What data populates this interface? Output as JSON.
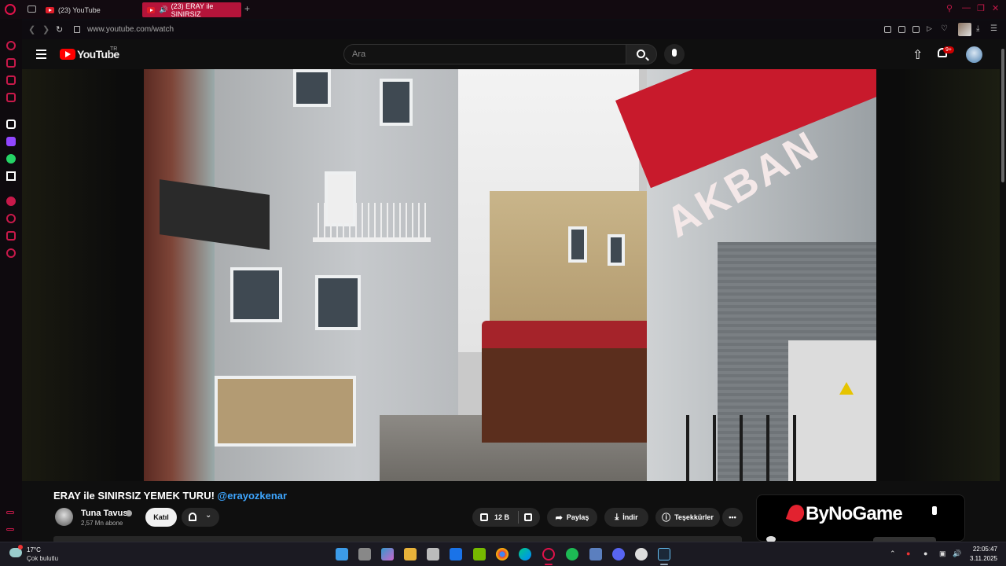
{
  "browser": {
    "tabs": [
      {
        "label": "(23) YouTube",
        "active": false
      },
      {
        "label": "(23) ERAY ile SINIRSIZ",
        "active": true
      }
    ],
    "new_tab": "+",
    "url": "www.youtube.com/watch",
    "accent": "#c8194a"
  },
  "youtube": {
    "logo_text": "YouTube",
    "country_code": "TR",
    "search_placeholder": "Ara",
    "notification_count": "9+"
  },
  "video": {
    "scene_sign": "AKBAN",
    "title_main": "ERAY ile SINIRSIZ YEMEK TURU! ",
    "title_mention": "@erayozkenar",
    "channel_name": "Tuna Tavus",
    "subscribers": "2,57 Mn abone",
    "join_label": "Katıl",
    "likes": "12 B",
    "share_label": "Paylaş",
    "download_label": "İndir",
    "thanks_label": "Teşekkürler",
    "more_label": "•••"
  },
  "ad": {
    "brand": "ByNoGame"
  },
  "taskbar": {
    "temperature": "17°C",
    "condition": "Çok bulutlu",
    "time": "22:05:47",
    "date": "3.11.2025",
    "apps": [
      "windows-start",
      "task-view",
      "copilot",
      "file-explorer",
      "microsoft-store",
      "outlook",
      "nvidia",
      "chrome",
      "edge",
      "opera-gx",
      "spotify",
      "steam-alt",
      "discord",
      "github",
      "steam"
    ]
  }
}
